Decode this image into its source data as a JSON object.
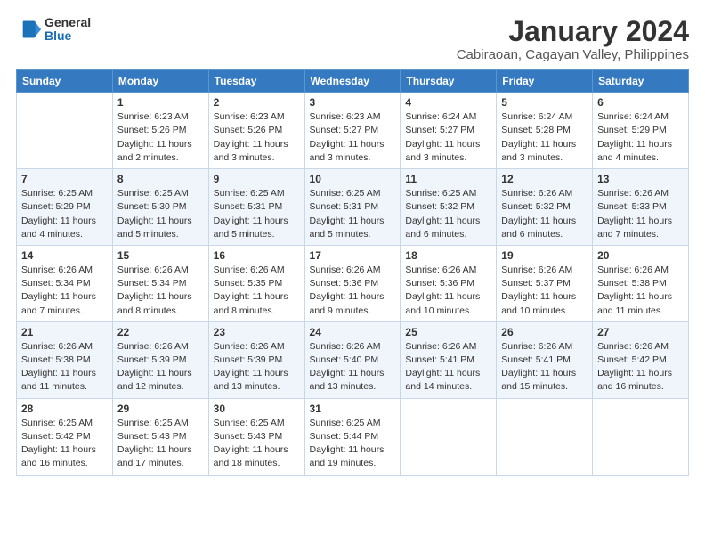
{
  "logo": {
    "general": "General",
    "blue": "Blue"
  },
  "title": {
    "month": "January 2024",
    "location": "Cabiraoan, Cagayan Valley, Philippines"
  },
  "weekdays": [
    "Sunday",
    "Monday",
    "Tuesday",
    "Wednesday",
    "Thursday",
    "Friday",
    "Saturday"
  ],
  "weeks": [
    [
      {
        "day": "",
        "info": ""
      },
      {
        "day": "1",
        "info": "Sunrise: 6:23 AM\nSunset: 5:26 PM\nDaylight: 11 hours\nand 2 minutes."
      },
      {
        "day": "2",
        "info": "Sunrise: 6:23 AM\nSunset: 5:26 PM\nDaylight: 11 hours\nand 3 minutes."
      },
      {
        "day": "3",
        "info": "Sunrise: 6:23 AM\nSunset: 5:27 PM\nDaylight: 11 hours\nand 3 minutes."
      },
      {
        "day": "4",
        "info": "Sunrise: 6:24 AM\nSunset: 5:27 PM\nDaylight: 11 hours\nand 3 minutes."
      },
      {
        "day": "5",
        "info": "Sunrise: 6:24 AM\nSunset: 5:28 PM\nDaylight: 11 hours\nand 3 minutes."
      },
      {
        "day": "6",
        "info": "Sunrise: 6:24 AM\nSunset: 5:29 PM\nDaylight: 11 hours\nand 4 minutes."
      }
    ],
    [
      {
        "day": "7",
        "info": "Sunrise: 6:25 AM\nSunset: 5:29 PM\nDaylight: 11 hours\nand 4 minutes."
      },
      {
        "day": "8",
        "info": "Sunrise: 6:25 AM\nSunset: 5:30 PM\nDaylight: 11 hours\nand 5 minutes."
      },
      {
        "day": "9",
        "info": "Sunrise: 6:25 AM\nSunset: 5:31 PM\nDaylight: 11 hours\nand 5 minutes."
      },
      {
        "day": "10",
        "info": "Sunrise: 6:25 AM\nSunset: 5:31 PM\nDaylight: 11 hours\nand 5 minutes."
      },
      {
        "day": "11",
        "info": "Sunrise: 6:25 AM\nSunset: 5:32 PM\nDaylight: 11 hours\nand 6 minutes."
      },
      {
        "day": "12",
        "info": "Sunrise: 6:26 AM\nSunset: 5:32 PM\nDaylight: 11 hours\nand 6 minutes."
      },
      {
        "day": "13",
        "info": "Sunrise: 6:26 AM\nSunset: 5:33 PM\nDaylight: 11 hours\nand 7 minutes."
      }
    ],
    [
      {
        "day": "14",
        "info": "Sunrise: 6:26 AM\nSunset: 5:34 PM\nDaylight: 11 hours\nand 7 minutes."
      },
      {
        "day": "15",
        "info": "Sunrise: 6:26 AM\nSunset: 5:34 PM\nDaylight: 11 hours\nand 8 minutes."
      },
      {
        "day": "16",
        "info": "Sunrise: 6:26 AM\nSunset: 5:35 PM\nDaylight: 11 hours\nand 8 minutes."
      },
      {
        "day": "17",
        "info": "Sunrise: 6:26 AM\nSunset: 5:36 PM\nDaylight: 11 hours\nand 9 minutes."
      },
      {
        "day": "18",
        "info": "Sunrise: 6:26 AM\nSunset: 5:36 PM\nDaylight: 11 hours\nand 10 minutes."
      },
      {
        "day": "19",
        "info": "Sunrise: 6:26 AM\nSunset: 5:37 PM\nDaylight: 11 hours\nand 10 minutes."
      },
      {
        "day": "20",
        "info": "Sunrise: 6:26 AM\nSunset: 5:38 PM\nDaylight: 11 hours\nand 11 minutes."
      }
    ],
    [
      {
        "day": "21",
        "info": "Sunrise: 6:26 AM\nSunset: 5:38 PM\nDaylight: 11 hours\nand 11 minutes."
      },
      {
        "day": "22",
        "info": "Sunrise: 6:26 AM\nSunset: 5:39 PM\nDaylight: 11 hours\nand 12 minutes."
      },
      {
        "day": "23",
        "info": "Sunrise: 6:26 AM\nSunset: 5:39 PM\nDaylight: 11 hours\nand 13 minutes."
      },
      {
        "day": "24",
        "info": "Sunrise: 6:26 AM\nSunset: 5:40 PM\nDaylight: 11 hours\nand 13 minutes."
      },
      {
        "day": "25",
        "info": "Sunrise: 6:26 AM\nSunset: 5:41 PM\nDaylight: 11 hours\nand 14 minutes."
      },
      {
        "day": "26",
        "info": "Sunrise: 6:26 AM\nSunset: 5:41 PM\nDaylight: 11 hours\nand 15 minutes."
      },
      {
        "day": "27",
        "info": "Sunrise: 6:26 AM\nSunset: 5:42 PM\nDaylight: 11 hours\nand 16 minutes."
      }
    ],
    [
      {
        "day": "28",
        "info": "Sunrise: 6:25 AM\nSunset: 5:42 PM\nDaylight: 11 hours\nand 16 minutes."
      },
      {
        "day": "29",
        "info": "Sunrise: 6:25 AM\nSunset: 5:43 PM\nDaylight: 11 hours\nand 17 minutes."
      },
      {
        "day": "30",
        "info": "Sunrise: 6:25 AM\nSunset: 5:43 PM\nDaylight: 11 hours\nand 18 minutes."
      },
      {
        "day": "31",
        "info": "Sunrise: 6:25 AM\nSunset: 5:44 PM\nDaylight: 11 hours\nand 19 minutes."
      },
      {
        "day": "",
        "info": ""
      },
      {
        "day": "",
        "info": ""
      },
      {
        "day": "",
        "info": ""
      }
    ]
  ]
}
